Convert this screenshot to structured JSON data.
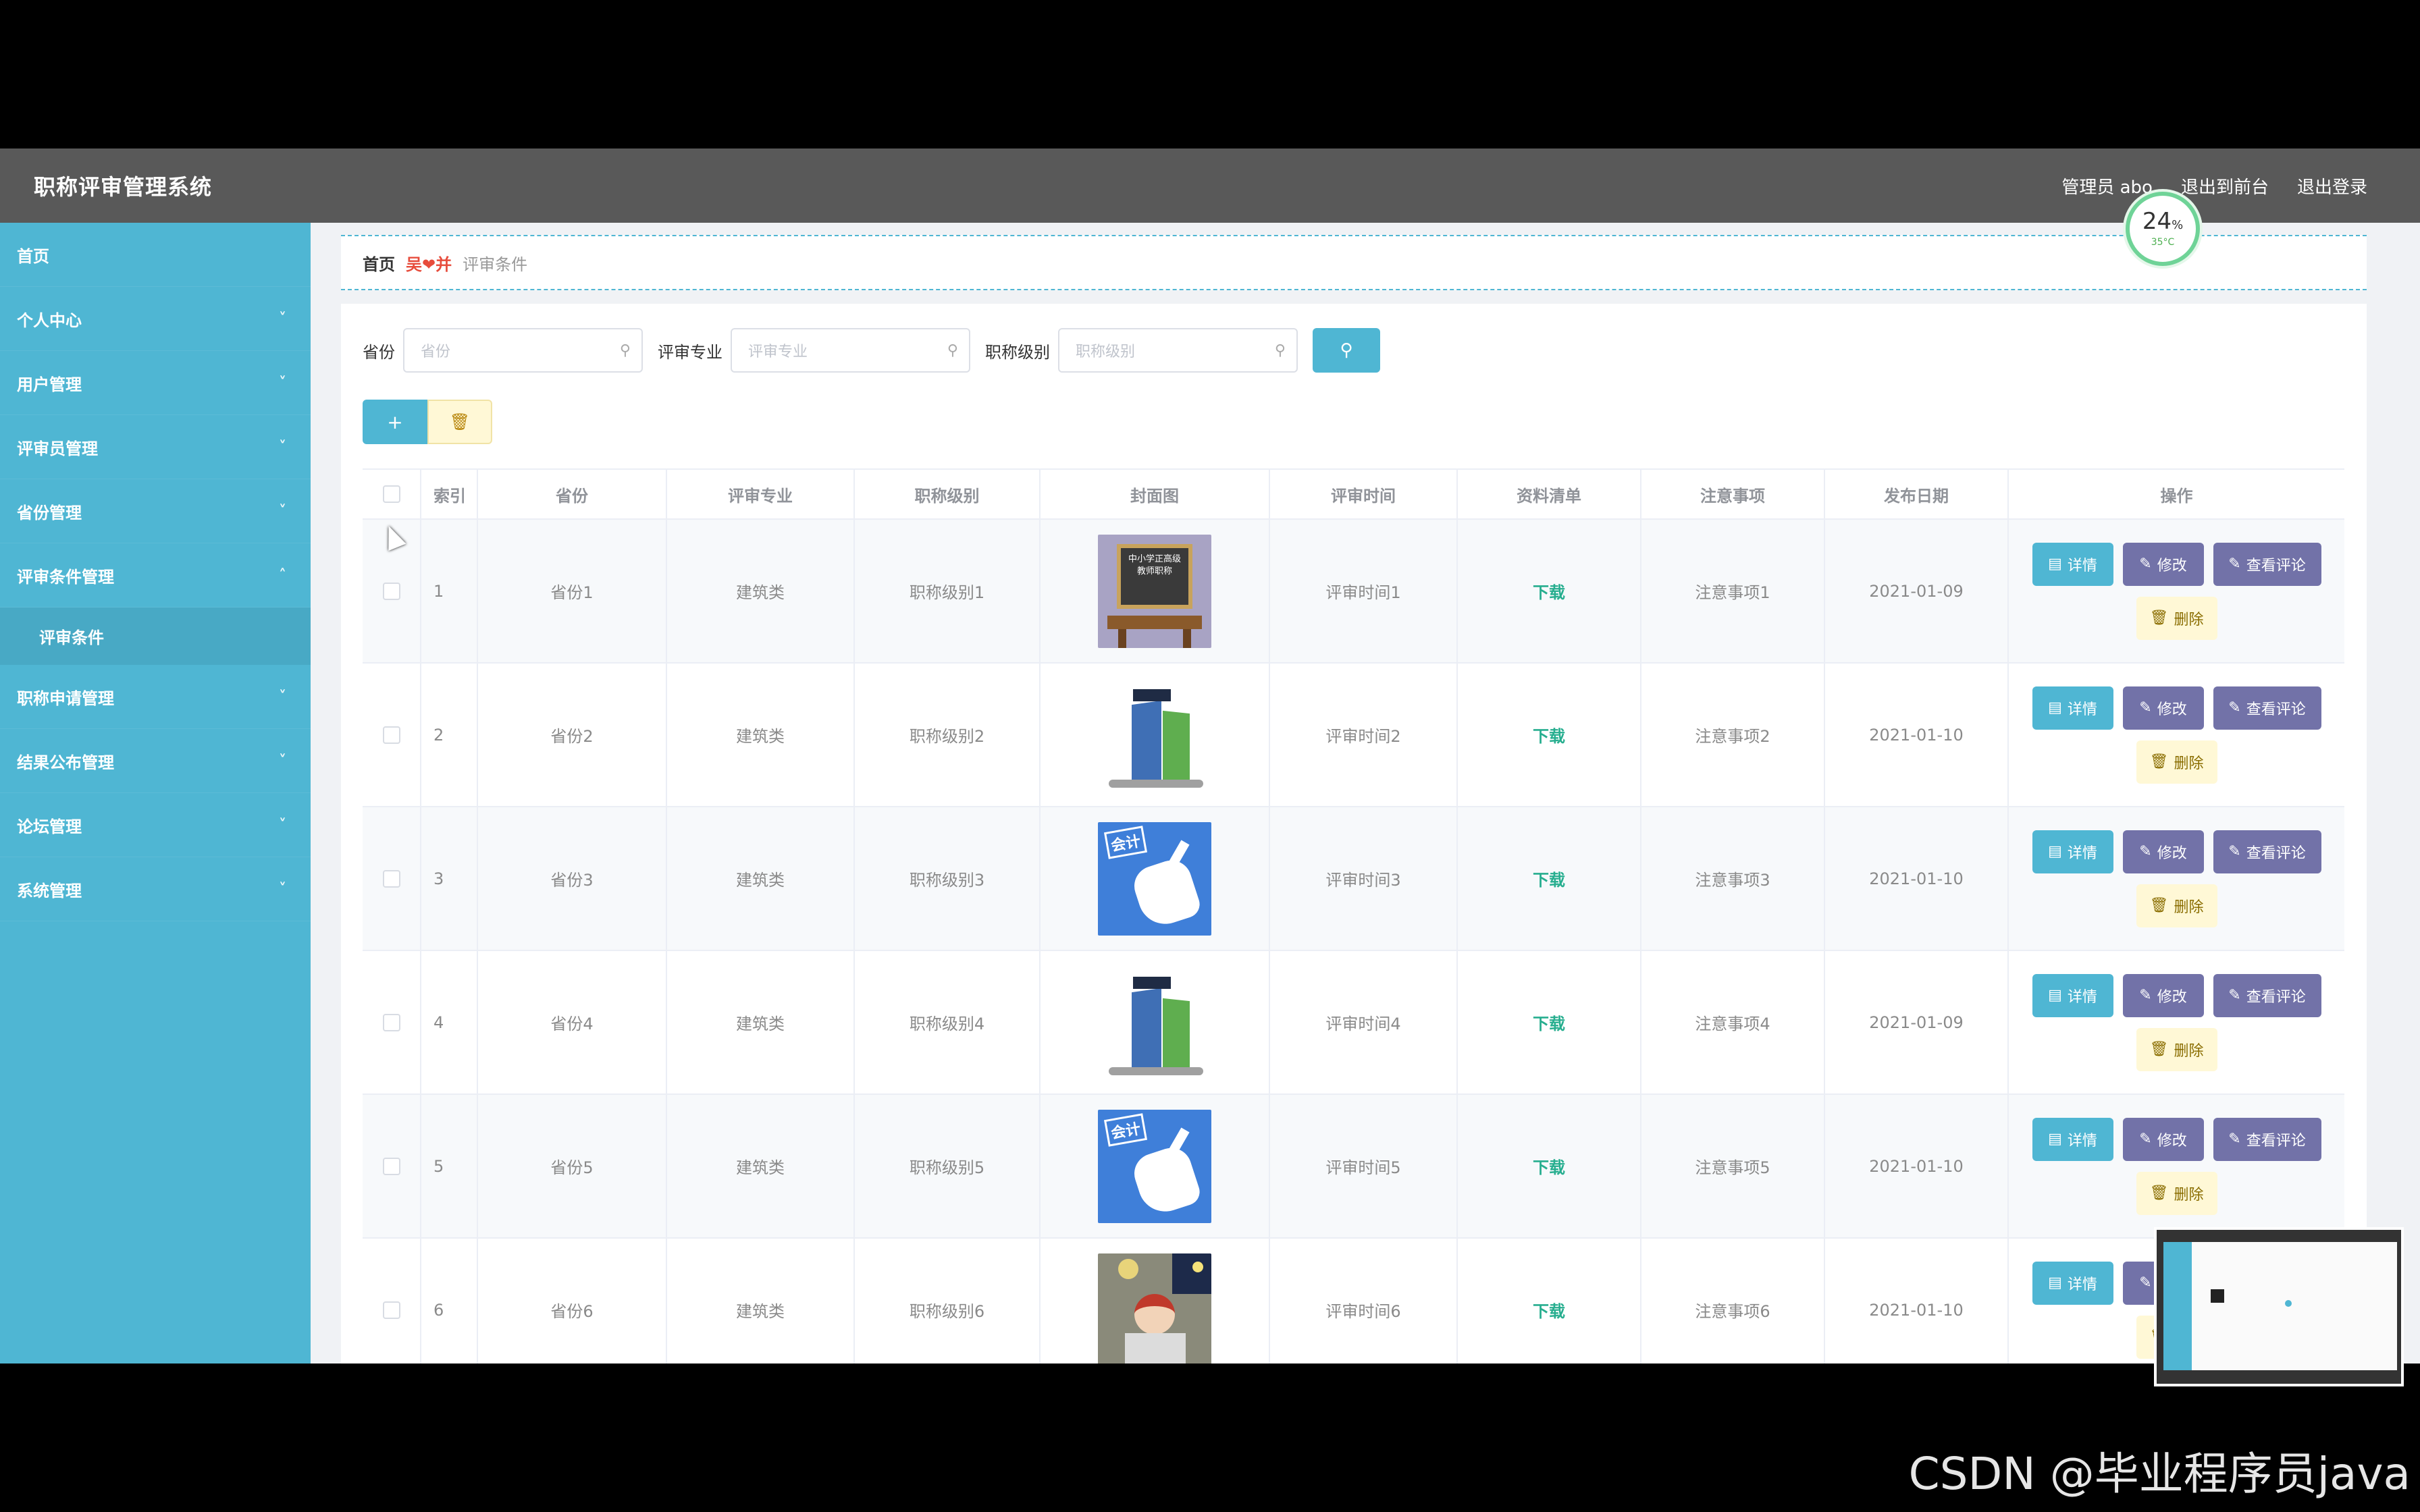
{
  "header": {
    "title": "职称评审管理系统",
    "user_label": "管理员 abo",
    "exit_front": "退出到前台",
    "logout": "退出登录"
  },
  "sidebar": {
    "items": [
      {
        "label": "首页",
        "chev": ""
      },
      {
        "label": "个人中心",
        "chev": "˅"
      },
      {
        "label": "用户管理",
        "chev": "˅"
      },
      {
        "label": "评审员管理",
        "chev": "˅"
      },
      {
        "label": "省份管理",
        "chev": "˅"
      },
      {
        "label": "评审条件管理",
        "chev": "˄"
      },
      {
        "label": "评审条件",
        "sub": true
      },
      {
        "label": "职称申请管理",
        "chev": "˅"
      },
      {
        "label": "结果公布管理",
        "chev": "˅"
      },
      {
        "label": "论坛管理",
        "chev": "˅"
      },
      {
        "label": "系统管理",
        "chev": "˅"
      }
    ]
  },
  "breadcrumb": {
    "home": "首页",
    "sep": "吴❤并",
    "current": "评审条件"
  },
  "search": {
    "province_label": "省份",
    "province_placeholder": "省份",
    "spec_label": "评审专业",
    "spec_placeholder": "评审专业",
    "level_label": "职称级别",
    "level_placeholder": "职称级别",
    "search_icon": "search-icon"
  },
  "actions": {
    "add_icon": "+",
    "delete_icon": "🗑"
  },
  "table": {
    "headers": [
      "",
      "索引",
      "省份",
      "评审专业",
      "职称级别",
      "封面图",
      "评审时间",
      "资料清单",
      "注意事项",
      "发布日期",
      "操作"
    ],
    "rows": [
      {
        "idx": "1",
        "province": "省份1",
        "spec": "建筑类",
        "level": "职称级别1",
        "time": "评审时间1",
        "doc": "下载",
        "note": "注意事项1",
        "date": "2021-01-09",
        "img": "chalkboard"
      },
      {
        "idx": "2",
        "province": "省份2",
        "spec": "建筑类",
        "level": "职称级别2",
        "time": "评审时间2",
        "doc": "下载",
        "note": "注意事项2",
        "date": "2021-01-10",
        "img": "graduate"
      },
      {
        "idx": "3",
        "province": "省份3",
        "spec": "建筑类",
        "level": "职称级别3",
        "time": "评审时间3",
        "doc": "下载",
        "note": "注意事项3",
        "date": "2021-01-10",
        "img": "accounting"
      },
      {
        "idx": "4",
        "province": "省份4",
        "spec": "建筑类",
        "level": "职称级别4",
        "time": "评审时间4",
        "doc": "下载",
        "note": "注意事项4",
        "date": "2021-01-09",
        "img": "graduate"
      },
      {
        "idx": "5",
        "province": "省份5",
        "spec": "建筑类",
        "level": "职称级别5",
        "time": "评审时间5",
        "doc": "下载",
        "note": "注意事项5",
        "date": "2021-01-10",
        "img": "accounting"
      },
      {
        "idx": "6",
        "province": "省份6",
        "spec": "建筑类",
        "level": "职称级别6",
        "time": "评审时间6",
        "doc": "下载",
        "note": "注意事项6",
        "date": "2021-01-10",
        "img": "student"
      }
    ],
    "ops": {
      "detail": "详情",
      "edit": "修改",
      "review": "查看评论",
      "delete": "删除"
    },
    "thumb_text": {
      "chalkboard": "中小学正高级教师职称",
      "accounting": "会计"
    }
  },
  "overlay": {
    "gauge_pct": "24",
    "gauge_unit": "%",
    "gauge_temp": "35°C",
    "watermark": "CSDN @毕业程序员java"
  },
  "colors": {
    "primary": "#4fb6d3",
    "header_bg": "#595959",
    "edit_btn": "#7272a8",
    "delete_btn_bg": "#fff8d6",
    "download_text": "#27ae8f"
  }
}
